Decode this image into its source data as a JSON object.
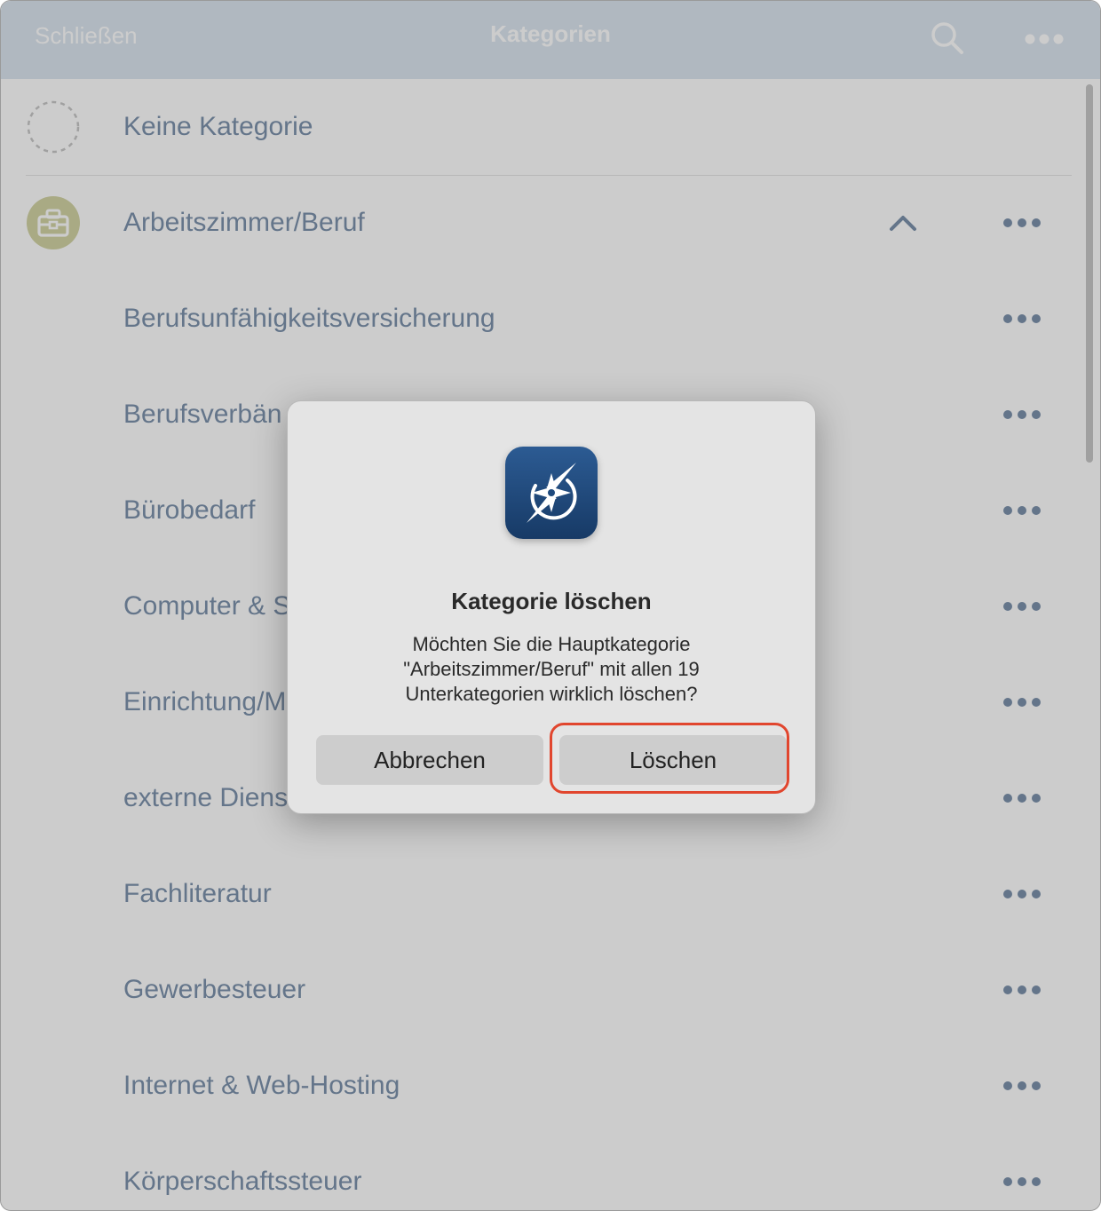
{
  "navbar": {
    "close_label": "Schließen",
    "title": "Kategorien",
    "search_icon": "search-icon",
    "more_icon": "more-icon"
  },
  "list": {
    "items": [
      {
        "label": "Keine Kategorie",
        "icon": "dashed-circle-icon"
      },
      {
        "label": "Arbeitszimmer/Beruf",
        "icon": "briefcase-icon",
        "expanded": true
      },
      {
        "label": "Berufsunfähigkeitsversicherung"
      },
      {
        "label": "Berufsverbän"
      },
      {
        "label": "Bürobedarf"
      },
      {
        "label": "Computer & S"
      },
      {
        "label": "Einrichtung/M"
      },
      {
        "label": "externe Diens"
      },
      {
        "label": "Fachliteratur"
      },
      {
        "label": "Gewerbesteuer"
      },
      {
        "label": "Internet & Web-Hosting"
      },
      {
        "label": "Körperschaftssteuer"
      }
    ]
  },
  "dialog": {
    "app_icon": "app-logo-icon",
    "title": "Kategorie löschen",
    "message_line1": "Möchten Sie die Hauptkategorie",
    "message_line2": "\"Arbeitszimmer/Beruf\" mit allen 19",
    "message_line3": "Unterkategorien wirklich löschen?",
    "cancel_label": "Abbrechen",
    "delete_label": "Löschen"
  },
  "colors": {
    "navbar": "#dde6f0",
    "list_text": "#7d93ad",
    "briefcase_badge": "#d4d5a6",
    "app_icon": "#1f4a7d",
    "highlight": "#e1462e"
  }
}
